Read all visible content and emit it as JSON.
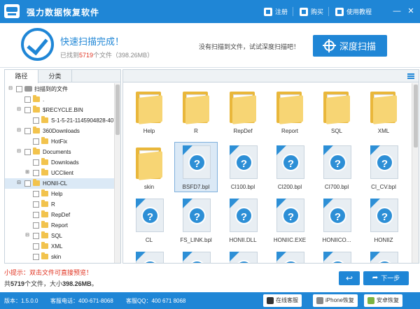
{
  "titlebar": {
    "app_title": "强力数据恢复软件",
    "menu": [
      {
        "label": "注册",
        "icon": "register-icon"
      },
      {
        "label": "购买",
        "icon": "cart-icon"
      },
      {
        "label": "使用教程",
        "icon": "book-icon"
      }
    ],
    "min": "—",
    "close": "✕"
  },
  "status": {
    "title": "快速扫描完成！",
    "found_prefix": "已找到",
    "found_count": "5719",
    "found_suffix": "个文件（398.26MB）",
    "hint": "没有扫描到文件，试试深度扫描吧！",
    "deep_scan_label": "深度扫描"
  },
  "left_panel": {
    "tab_path": "路径",
    "tab_category": "分类",
    "tree": [
      {
        "label": "扫描到的文件",
        "expand": "⊟",
        "icon": "drive"
      },
      {
        "label": ".",
        "expand": "",
        "icon": "folder"
      },
      {
        "label": "$RECYCLE.BIN",
        "expand": "⊟",
        "icon": "folder"
      },
      {
        "label": "S-1-5-21-1145904828-407",
        "expand": "",
        "icon": "folder"
      },
      {
        "label": "360Downloads",
        "expand": "⊟",
        "icon": "folder"
      },
      {
        "label": "HotFix",
        "expand": "",
        "icon": "folder"
      },
      {
        "label": "Documents",
        "expand": "⊟",
        "icon": "folder"
      },
      {
        "label": "Downloads",
        "expand": "",
        "icon": "folder"
      },
      {
        "label": "UCClient",
        "expand": "⊞",
        "icon": "folder"
      },
      {
        "label": "HONII-CL",
        "expand": "⊟",
        "icon": "folder",
        "selected": true
      },
      {
        "label": "Help",
        "expand": "",
        "icon": "folder"
      },
      {
        "label": "R",
        "expand": "",
        "icon": "folder"
      },
      {
        "label": "RepDef",
        "expand": "",
        "icon": "folder"
      },
      {
        "label": "Report",
        "expand": "",
        "icon": "folder"
      },
      {
        "label": "SQL",
        "expand": "⊟",
        "icon": "folder"
      },
      {
        "label": "XML",
        "expand": "",
        "icon": "folder"
      },
      {
        "label": "skin",
        "expand": "",
        "icon": "folder"
      }
    ]
  },
  "grid": {
    "items": [
      {
        "name": "Help",
        "type": "folder"
      },
      {
        "name": "R",
        "type": "folder"
      },
      {
        "name": "RepDef",
        "type": "folder"
      },
      {
        "name": "Report",
        "type": "folder"
      },
      {
        "name": "SQL",
        "type": "folder"
      },
      {
        "name": "XML",
        "type": "folder"
      },
      {
        "name": "skin",
        "type": "folder"
      },
      {
        "name": "BSFD7.bpl",
        "type": "file",
        "selected": true
      },
      {
        "name": "CI100.bpl",
        "type": "file"
      },
      {
        "name": "CI200.bpl",
        "type": "file"
      },
      {
        "name": "CI700.bpl",
        "type": "file"
      },
      {
        "name": "CI_CV.bpl",
        "type": "file"
      },
      {
        "name": "CL",
        "type": "file"
      },
      {
        "name": "FS_LINK.bpl",
        "type": "file"
      },
      {
        "name": "HONII.DLL",
        "type": "file"
      },
      {
        "name": "HONIIC.EXE",
        "type": "file"
      },
      {
        "name": "HONIICO...",
        "type": "file"
      },
      {
        "name": "HONIIZ",
        "type": "file"
      },
      {
        "name": "",
        "type": "file"
      },
      {
        "name": "",
        "type": "file"
      },
      {
        "name": "",
        "type": "file"
      },
      {
        "name": "",
        "type": "file"
      },
      {
        "name": "",
        "type": "file"
      },
      {
        "name": "",
        "type": "file"
      }
    ]
  },
  "bottom": {
    "tip": "小提示：双击文件可直接预览！",
    "summary_prefix": "共",
    "summary_count": "5719",
    "summary_mid": "个文件，大小",
    "summary_size": "398.26MB",
    "summary_end": "。",
    "back_label": "↩",
    "next_label": "下一步"
  },
  "footer": {
    "version": "版本：1.5.0.0",
    "phone": "客服电话：400-671-8068",
    "qq": "客服QQ：400 671 8068",
    "online_service": "在线客服",
    "iphone_recovery": "iPhone恢复",
    "android_recovery": "安卓恢复"
  },
  "colors": {
    "accent": "#1f86d6",
    "alert": "#e0301e",
    "folder": "#f2c34d"
  }
}
